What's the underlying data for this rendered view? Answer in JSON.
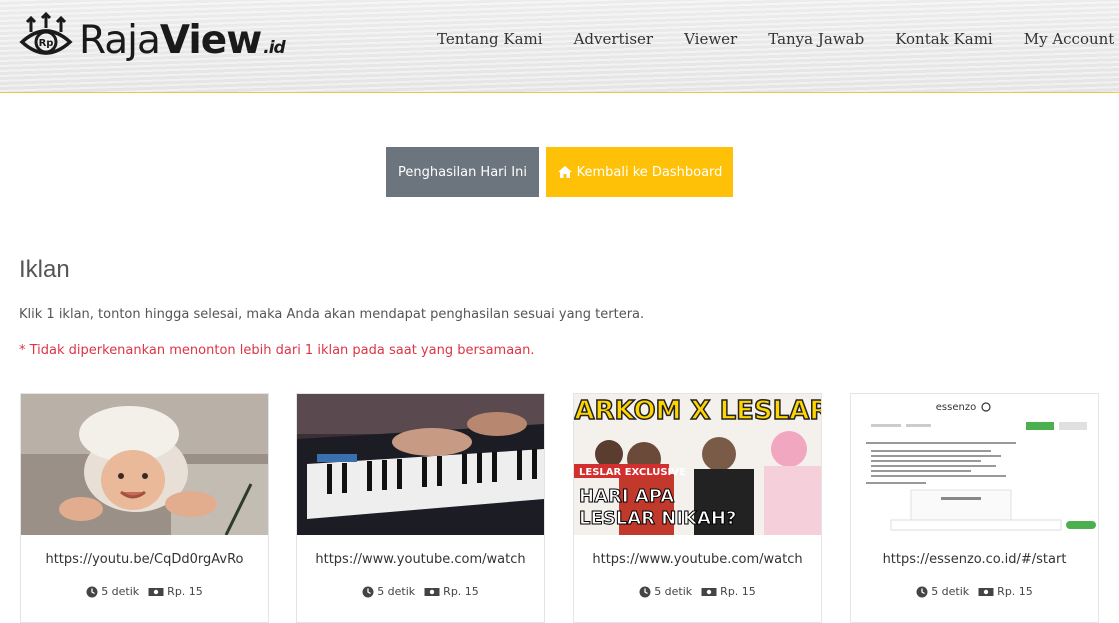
{
  "brand": {
    "name_part1": "Raja",
    "name_part2": "View",
    "tld": ".id"
  },
  "nav": {
    "items": [
      "Tentang Kami",
      "Advertiser",
      "Viewer",
      "Tanya Jawab",
      "Kontak Kami"
    ],
    "account": "My Account"
  },
  "buttons": {
    "earnings": "Penghasilan Hari Ini",
    "dashboard": "Kembali ke Dashboard"
  },
  "section": {
    "title": "Iklan",
    "description": "Klik 1 iklan, tonton hingga selesai, maka Anda akan mendapat penghasilan sesuai yang tertera.",
    "warning": "* Tidak diperkenankan menonton lebih dari 1 iklan pada saat yang bersamaan."
  },
  "ads": [
    {
      "url": "https://youtu.be/CqDd0rgAvRo",
      "duration": "5 detik",
      "reward": "Rp. 15"
    },
    {
      "url": "https://www.youtube.com/watch",
      "duration": "5 detik",
      "reward": "Rp. 15"
    },
    {
      "url": "https://www.youtube.com/watch",
      "duration": "5 detik",
      "reward": "Rp. 15",
      "thumb_title": "JARKOM X LESLAR",
      "thumb_badge": "LESLAR EXCLUSIVE",
      "thumb_caption_1": "HARI APA",
      "thumb_caption_2": "LESLAR NIKAH?"
    },
    {
      "url": "https://essenzo.co.id/#/start",
      "duration": "5 detik",
      "reward": "Rp. 15",
      "thumb_brand": "essenzo"
    }
  ],
  "colors": {
    "accent_yellow": "#ffc107",
    "secondary_gray": "#6c757d",
    "danger_red": "#dc3545"
  }
}
